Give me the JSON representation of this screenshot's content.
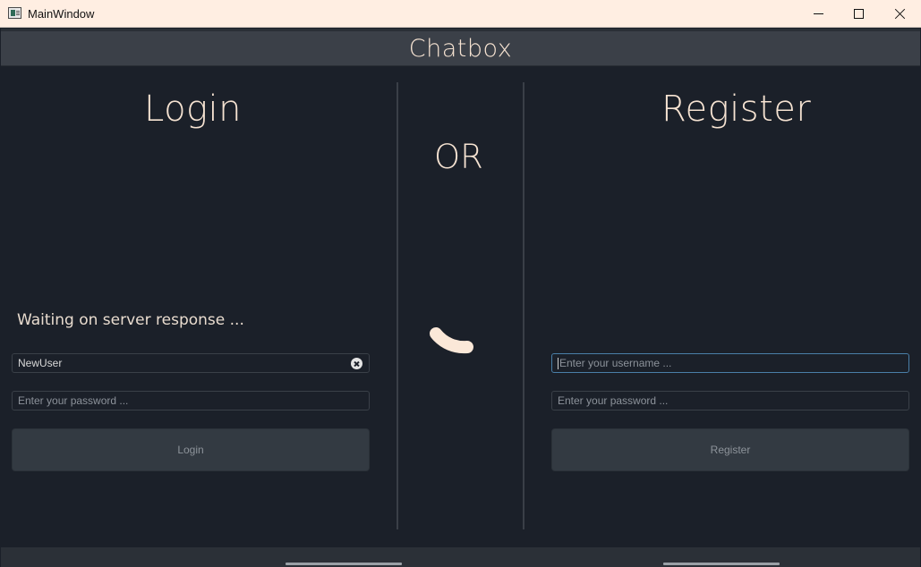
{
  "window": {
    "title": "MainWindow"
  },
  "header": {
    "title": "Chatbox"
  },
  "login": {
    "heading": "Login",
    "status": "Waiting on server response ...",
    "username_value": "NewUser",
    "password_placeholder": "Enter your password ...",
    "button_label": "Login"
  },
  "separator": {
    "label": "OR"
  },
  "register": {
    "heading": "Register",
    "username_placeholder": "Enter your username ...",
    "password_placeholder": "Enter your password ...",
    "button_label": "Register"
  },
  "colors": {
    "background": "#1b2029",
    "accent_text": "#f6e3d2",
    "button": "#333a42",
    "focus_border": "#4a7fa8",
    "titlebar": "#ffeee2"
  },
  "icons": {
    "app": "window-app-icon",
    "minimize": "minimize-icon",
    "maximize": "maximize-icon",
    "close": "close-icon",
    "clear": "clear-input-icon",
    "loading": "loading-spinner-icon"
  }
}
